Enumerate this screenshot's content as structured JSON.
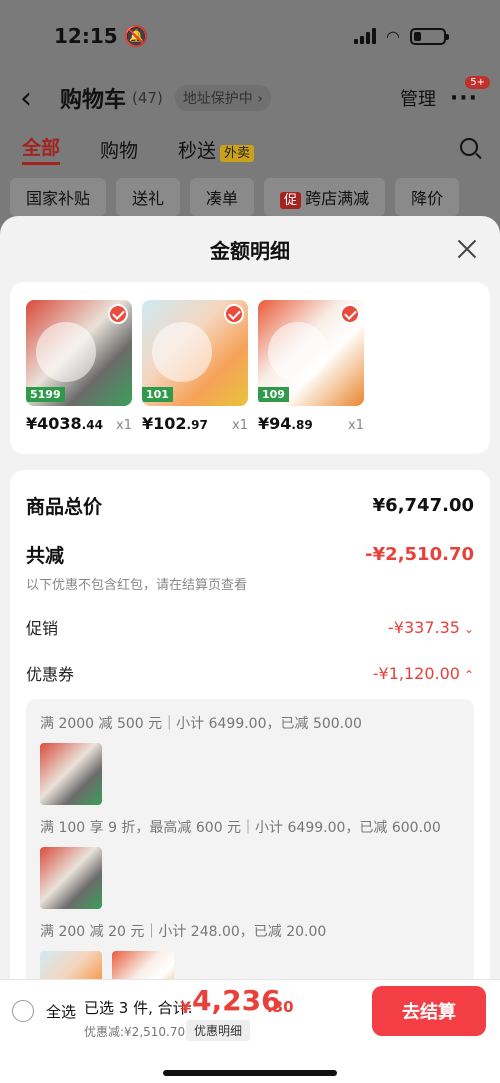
{
  "status_bar": {
    "time": "12:15",
    "battery_level": 0.25
  },
  "header": {
    "title": "购物车",
    "count": "(47)",
    "address_protect": "地址保护中",
    "manage": "管理",
    "more": "···",
    "badge": "5+"
  },
  "tabs": [
    {
      "label": "全部",
      "active": true
    },
    {
      "label": "购物"
    },
    {
      "label": "秒送",
      "tag": "外卖"
    }
  ],
  "filters": [
    "国家补贴",
    "送礼",
    "凑单",
    "跨店满减",
    "降价"
  ],
  "filter_promo_tag": "促",
  "sheet": {
    "title": "金额明细",
    "products": [
      {
        "price_int": "¥4038",
        "price_dec": ".44",
        "qty": "x1",
        "img_tag": "5199"
      },
      {
        "price_int": "¥102",
        "price_dec": ".97",
        "qty": "x1",
        "img_tag": "101"
      },
      {
        "price_int": "¥94",
        "price_dec": ".89",
        "qty": "x1",
        "img_tag": "109"
      }
    ],
    "summary": {
      "total_label": "商品总价",
      "total_value": "¥6,747.00",
      "reduce_label": "共减",
      "reduce_value": "-¥2,510.70",
      "reduce_hint": "以下优惠不包含红包，请在结算页查看",
      "promo_label": "促销",
      "promo_value": "-¥337.35",
      "coupon_label": "优惠券",
      "coupon_value": "-¥1,120.00"
    },
    "coupons": [
      {
        "text": "满 2000 减 500 元｜小计 6499.00，已减 500.00"
      },
      {
        "text": "满 100 享 9 折，最高减 600 元｜小计 6499.00，已减 600.00"
      },
      {
        "text": "满 200 减 20 元｜小计 248.00，已减 20.00"
      }
    ]
  },
  "bottom_bar": {
    "select_all": "全选",
    "selected": "已选 3 件, 合计:",
    "currency": "¥",
    "total_int": "4,236",
    "total_dec": ".30",
    "discount": "优惠减:¥2,510.70",
    "detail_chip": "优惠明细",
    "checkout": "去结算"
  },
  "colors": {
    "accent": "#e8403a",
    "checkout": "#f33e45"
  }
}
